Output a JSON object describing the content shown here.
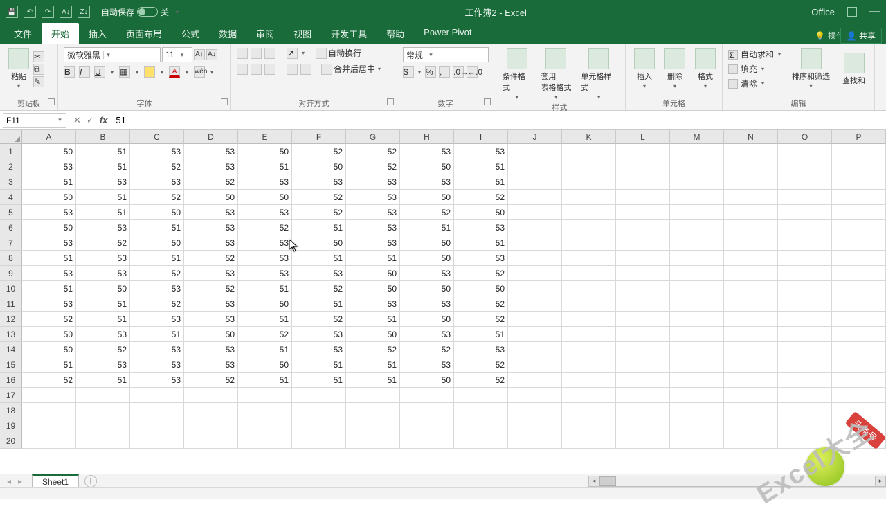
{
  "titlebar": {
    "autosave_label": "自动保存",
    "autosave_state": "关",
    "doc_title": "工作簿2  -  Excel",
    "office_label": "Office"
  },
  "tabs": {
    "items": [
      "文件",
      "开始",
      "插入",
      "页面布局",
      "公式",
      "数据",
      "审阅",
      "视图",
      "开发工具",
      "帮助",
      "Power Pivot"
    ],
    "active_index": 1,
    "search_hint": "操作说明搜索",
    "share_label": "共享"
  },
  "ribbon": {
    "clipboard": {
      "paste": "粘贴",
      "label": "剪贴板"
    },
    "font": {
      "name": "微软雅黑",
      "size": "11",
      "label": "字体"
    },
    "alignment": {
      "wrap": "自动换行",
      "merge": "合并后居中",
      "label": "对齐方式"
    },
    "number": {
      "format": "常规",
      "label": "数字"
    },
    "styles": {
      "cond": "条件格式",
      "table": "套用\n表格格式",
      "cell": "单元格样式",
      "label": "样式"
    },
    "cells": {
      "insert": "插入",
      "delete": "删除",
      "format": "格式",
      "label": "单元格"
    },
    "editing": {
      "sum": "自动求和",
      "fill": "填充",
      "clear": "清除",
      "sort": "排序和筛选",
      "find": "查找和",
      "label": "编辑"
    }
  },
  "formula_bar": {
    "cell_ref": "F11",
    "formula": "51"
  },
  "grid": {
    "columns": [
      "A",
      "B",
      "C",
      "D",
      "E",
      "F",
      "G",
      "H",
      "I",
      "J",
      "K",
      "L",
      "M",
      "N",
      "O",
      "P"
    ],
    "row_count": 20,
    "data": [
      [
        50,
        51,
        53,
        53,
        50,
        52,
        52,
        53,
        53
      ],
      [
        53,
        51,
        52,
        53,
        51,
        50,
        52,
        50,
        51
      ],
      [
        51,
        53,
        53,
        52,
        53,
        53,
        53,
        53,
        51
      ],
      [
        50,
        51,
        52,
        50,
        50,
        52,
        53,
        50,
        52
      ],
      [
        53,
        51,
        50,
        53,
        53,
        52,
        53,
        52,
        50
      ],
      [
        50,
        53,
        51,
        53,
        52,
        51,
        53,
        51,
        53
      ],
      [
        53,
        52,
        50,
        53,
        53,
        50,
        53,
        50,
        51
      ],
      [
        51,
        53,
        51,
        52,
        53,
        51,
        51,
        50,
        53
      ],
      [
        53,
        53,
        52,
        53,
        53,
        53,
        50,
        53,
        52
      ],
      [
        51,
        50,
        53,
        52,
        51,
        52,
        50,
        50,
        50
      ],
      [
        53,
        51,
        52,
        53,
        50,
        51,
        53,
        53,
        52
      ],
      [
        52,
        51,
        53,
        53,
        51,
        52,
        51,
        50,
        52
      ],
      [
        50,
        53,
        51,
        50,
        52,
        53,
        50,
        53,
        51
      ],
      [
        50,
        52,
        53,
        53,
        51,
        53,
        52,
        52,
        53
      ],
      [
        51,
        53,
        53,
        53,
        50,
        51,
        51,
        53,
        52
      ],
      [
        52,
        51,
        53,
        52,
        51,
        51,
        51,
        50,
        52
      ]
    ]
  },
  "chart_data": {
    "type": "table",
    "title": "",
    "columns": [
      "A",
      "B",
      "C",
      "D",
      "E",
      "F",
      "G",
      "H",
      "I"
    ],
    "rows": [
      [
        50,
        51,
        53,
        53,
        50,
        52,
        52,
        53,
        53
      ],
      [
        53,
        51,
        52,
        53,
        51,
        50,
        52,
        50,
        51
      ],
      [
        51,
        53,
        53,
        52,
        53,
        53,
        53,
        53,
        51
      ],
      [
        50,
        51,
        52,
        50,
        50,
        52,
        53,
        50,
        52
      ],
      [
        53,
        51,
        50,
        53,
        53,
        52,
        53,
        52,
        50
      ],
      [
        50,
        53,
        51,
        53,
        52,
        51,
        53,
        51,
        53
      ],
      [
        53,
        52,
        50,
        53,
        53,
        50,
        53,
        50,
        51
      ],
      [
        51,
        53,
        51,
        52,
        53,
        51,
        51,
        50,
        53
      ],
      [
        53,
        53,
        52,
        53,
        53,
        53,
        50,
        53,
        52
      ],
      [
        51,
        50,
        53,
        52,
        51,
        52,
        50,
        50,
        50
      ],
      [
        53,
        51,
        52,
        53,
        50,
        51,
        53,
        53,
        52
      ],
      [
        52,
        51,
        53,
        53,
        51,
        52,
        51,
        50,
        52
      ],
      [
        50,
        53,
        51,
        50,
        52,
        53,
        50,
        53,
        51
      ],
      [
        50,
        52,
        53,
        53,
        51,
        53,
        52,
        52,
        53
      ],
      [
        51,
        53,
        53,
        53,
        50,
        51,
        51,
        53,
        52
      ],
      [
        52,
        51,
        53,
        52,
        51,
        51,
        51,
        50,
        52
      ]
    ]
  },
  "sheets": {
    "active": "Sheet1"
  },
  "watermark": {
    "text": "Excel大全",
    "badge": "头条号"
  }
}
